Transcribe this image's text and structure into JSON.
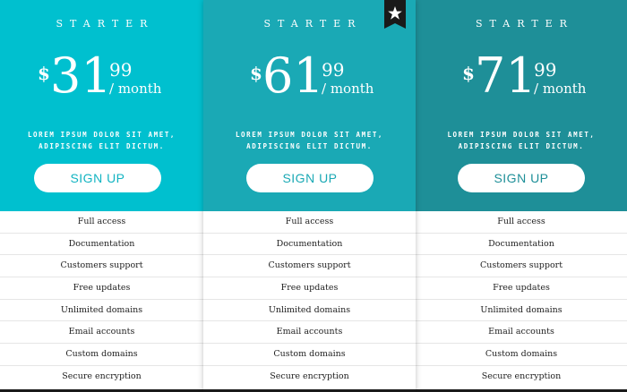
{
  "plans": [
    {
      "tier": "STARTER",
      "currency": "$",
      "amount": "31",
      "cents": "99",
      "period": "/ month",
      "desc_line1": "LOREM IPSUM DOLOR SIT AMET,",
      "desc_line2": "ADIPISCING ELIT DICTUM.",
      "button": "SIGN UP",
      "features": [
        "Full access",
        "Documentation",
        "Customers support",
        "Free updates",
        "Unlimited domains",
        "Email accounts",
        "Custom domains",
        "Secure encryption"
      ]
    },
    {
      "tier": "STARTER",
      "currency": "$",
      "amount": "61",
      "cents": "99",
      "period": "/ month",
      "desc_line1": "LOREM IPSUM DOLOR SIT AMET,",
      "desc_line2": "ADIPISCING ELIT DICTUM.",
      "button": "SIGN UP",
      "featured": true,
      "features": [
        "Full access",
        "Documentation",
        "Customers support",
        "Free updates",
        "Unlimited domains",
        "Email accounts",
        "Custom domains",
        "Secure encryption"
      ]
    },
    {
      "tier": "STARTER",
      "currency": "$",
      "amount": "71",
      "cents": "99",
      "period": "/ month",
      "desc_line1": "LOREM IPSUM DOLOR SIT AMET,",
      "desc_line2": "ADIPISCING ELIT DICTUM.",
      "button": "SIGN UP",
      "features": [
        "Full access",
        "Documentation",
        "Customers support",
        "Free updates",
        "Unlimited domains",
        "Email accounts",
        "Custom domains",
        "Secure encryption"
      ]
    }
  ],
  "colors": {
    "plan1": "#00c0cf",
    "plan2": "#1aa9b5",
    "plan3": "#1e8f98",
    "badge": "#1a1a1a"
  },
  "icons": {
    "featured_badge": "star-icon"
  }
}
